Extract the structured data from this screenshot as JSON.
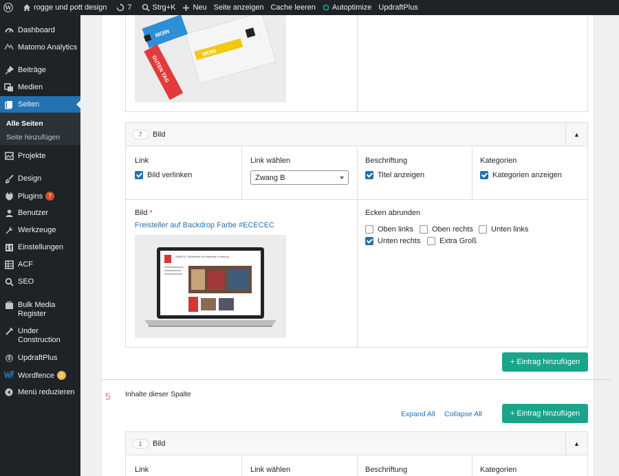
{
  "colors": {
    "admin_bg": "#1d2327",
    "accent": "#2271b1",
    "green": "#1aa58a",
    "badge_orange": "#d54e21",
    "badge_yellow": "#f0b849"
  },
  "adminbar": {
    "site": "rogge und pott design",
    "updates": "7",
    "search": "Strg+K",
    "new": "Neu",
    "view": "Seite anzeigen",
    "cache": "Cache leeren",
    "autoptimize": "Autoptimize",
    "updraft": "UpdraftPlus"
  },
  "sidebar": {
    "items": [
      {
        "label": "Dashboard",
        "icon": "dashboard-icon"
      },
      {
        "label": "Matomo Analytics",
        "icon": "matomo-icon"
      },
      {
        "label": "Beiträge",
        "icon": "pin-icon"
      },
      {
        "label": "Medien",
        "icon": "media-icon"
      },
      {
        "label": "Seiten",
        "icon": "pages-icon"
      },
      {
        "label": "Projekte",
        "icon": "portfolio-icon"
      },
      {
        "label": "Design",
        "icon": "brush-icon"
      },
      {
        "label": "Plugins",
        "icon": "plugin-icon",
        "badge": "7"
      },
      {
        "label": "Benutzer",
        "icon": "users-icon"
      },
      {
        "label": "Werkzeuge",
        "icon": "wrench-icon"
      },
      {
        "label": "Einstellungen",
        "icon": "settings-icon"
      },
      {
        "label": "ACF",
        "icon": "acf-icon"
      },
      {
        "label": "SEO",
        "icon": "search-icon"
      },
      {
        "label": "Bulk Media Register",
        "icon": "bulk-media-icon"
      },
      {
        "label": "Under Construction",
        "icon": "construction-icon"
      },
      {
        "label": "UpdraftPlus",
        "icon": "updraft-icon"
      },
      {
        "label": "Wordfence",
        "icon": "wordfence-icon",
        "badge": "2"
      },
      {
        "label": "Menü reduzieren",
        "icon": "collapse-icon"
      }
    ],
    "submenu": {
      "all": "Alle Seiten",
      "add": "Seite hinzufügen"
    }
  },
  "entry7": {
    "number": "7",
    "type": "Bild",
    "link_label": "Link",
    "link_checkbox": "Bild verlinken",
    "choose_label": "Link wählen",
    "choose_value": "Zwang B",
    "caption_label": "Beschriftung",
    "caption_checkbox": "Titel anzeigen",
    "cat_label": "Kategorien",
    "cat_checkbox": "Kategorien anzeigen",
    "image_label": "Bild",
    "required": "*",
    "image_name": "Freisteller auf Backdrop Farbe #ECECEC",
    "corners_label": "Ecken abrunden",
    "corners": [
      {
        "label": "Oben links",
        "checked": false
      },
      {
        "label": "Oben rechts",
        "checked": false
      },
      {
        "label": "Unten links",
        "checked": false
      },
      {
        "label": "Unten rechts",
        "checked": true
      },
      {
        "label": "Extra Groß",
        "checked": false
      }
    ]
  },
  "add_entry": "+ Eintrag hinzufügen",
  "column5": {
    "number": "5",
    "label": "Inhalte dieser Spalte",
    "expand_all": "Expand All",
    "collapse_all": "Collapse All",
    "add_entry": "+ Eintrag hinzufügen"
  },
  "entry1": {
    "number": "1",
    "type": "Bild",
    "link_label": "Link",
    "choose_label": "Link wählen",
    "caption_label": "Beschriftung",
    "cat_label": "Kategorien"
  },
  "mockup": {
    "card_text": "MOIN",
    "card_text2": "MOIN",
    "red_text": "GUTEN TAG",
    "laptop_caption": "ZWANG B - Buchbinderei und Papierladen in Hamburg"
  }
}
